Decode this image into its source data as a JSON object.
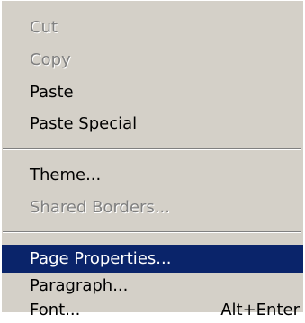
{
  "menu": {
    "items": [
      {
        "label": "Cut",
        "state": "disabled"
      },
      {
        "label": "Copy",
        "state": "disabled"
      },
      {
        "label": "Paste",
        "state": "enabled"
      },
      {
        "label": "Paste Special",
        "state": "enabled"
      },
      {
        "label": "Theme...",
        "state": "enabled"
      },
      {
        "label": "Shared Borders...",
        "state": "disabled"
      },
      {
        "label": "Page Properties...",
        "state": "highlighted"
      },
      {
        "label": "Paragraph...",
        "state": "enabled"
      },
      {
        "label": "Font...",
        "shortcut": "Alt+Enter",
        "state": "enabled"
      }
    ]
  },
  "colors": {
    "menu_background": "#d4d0c8",
    "highlight_background": "#0a246a",
    "highlight_text": "#ffffff",
    "disabled_text": "#808080",
    "separator_dark": "#808080",
    "separator_light": "#ffffff"
  }
}
